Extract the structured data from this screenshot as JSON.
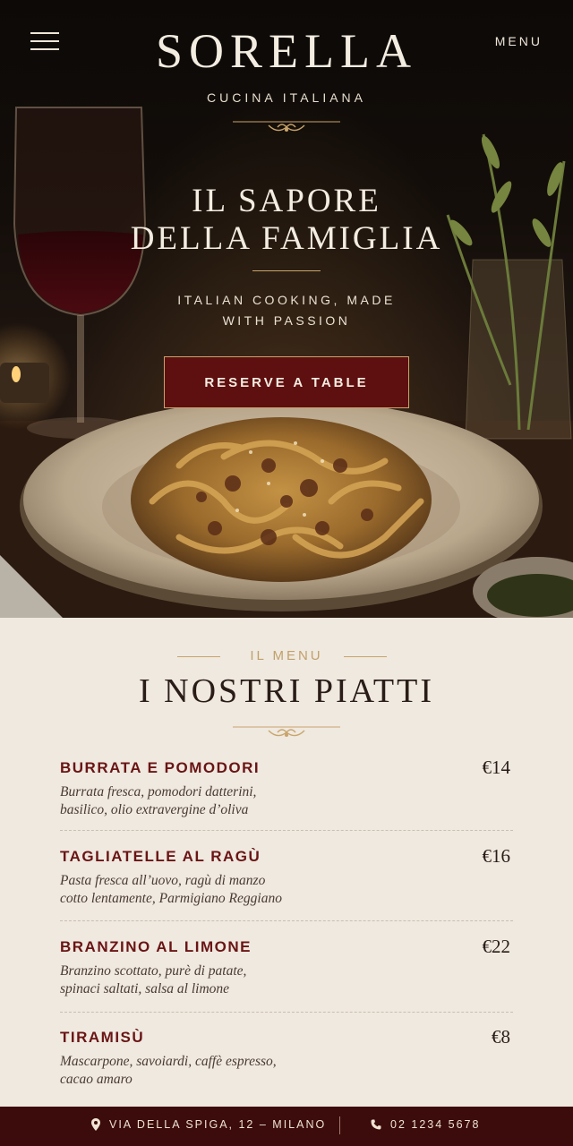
{
  "header": {
    "menu_label": "MENU",
    "hamburger_icon": "hamburger-icon"
  },
  "brand": {
    "name": "SORELLA",
    "subtitle": "CUCINA ITALIANA"
  },
  "hero": {
    "title_line1": "IL SAPORE",
    "title_line2": "DELLA FAMIGLIA",
    "tagline_line1": "ITALIAN COOKING, MADE",
    "tagline_line2": "WITH PASSION",
    "cta_label": "RESERVE A TABLE"
  },
  "menu": {
    "eyebrow": "IL MENU",
    "heading": "I NOSTRI PIATTI",
    "dishes": [
      {
        "name": "BURRATA E POMODORI",
        "price": "€14",
        "desc_line1": "Burrata fresca, pomodori datterini,",
        "desc_line2": "basilico, olio extravergine d’oliva"
      },
      {
        "name": "TAGLIATELLE AL RAGÙ",
        "price": "€16",
        "desc_line1": "Pasta fresca all’uovo, ragù di manzo",
        "desc_line2": "cotto lentamente, Parmigiano Reggiano"
      },
      {
        "name": "BRANZINO AL LIMONE",
        "price": "€22",
        "desc_line1": "Branzino scottato, purè di patate,",
        "desc_line2": "spinaci saltati, salsa al limone"
      },
      {
        "name": "TIRAMISÙ",
        "price": "€8",
        "desc_line1": "Mascarpone, savoiardi, caffè espresso,",
        "desc_line2": "cacao amaro"
      }
    ]
  },
  "footer": {
    "address": "VIA DELLA SPIGA, 12 – MILANO",
    "address_icon": "map-pin-icon",
    "phone": "02 1234 5678",
    "phone_icon": "phone-icon"
  },
  "colors": {
    "accent_gold": "#c9a46b",
    "wine_red": "#5e0f0f",
    "footer_bg": "#3c0b0b",
    "cream_bg": "#efe9e0"
  }
}
